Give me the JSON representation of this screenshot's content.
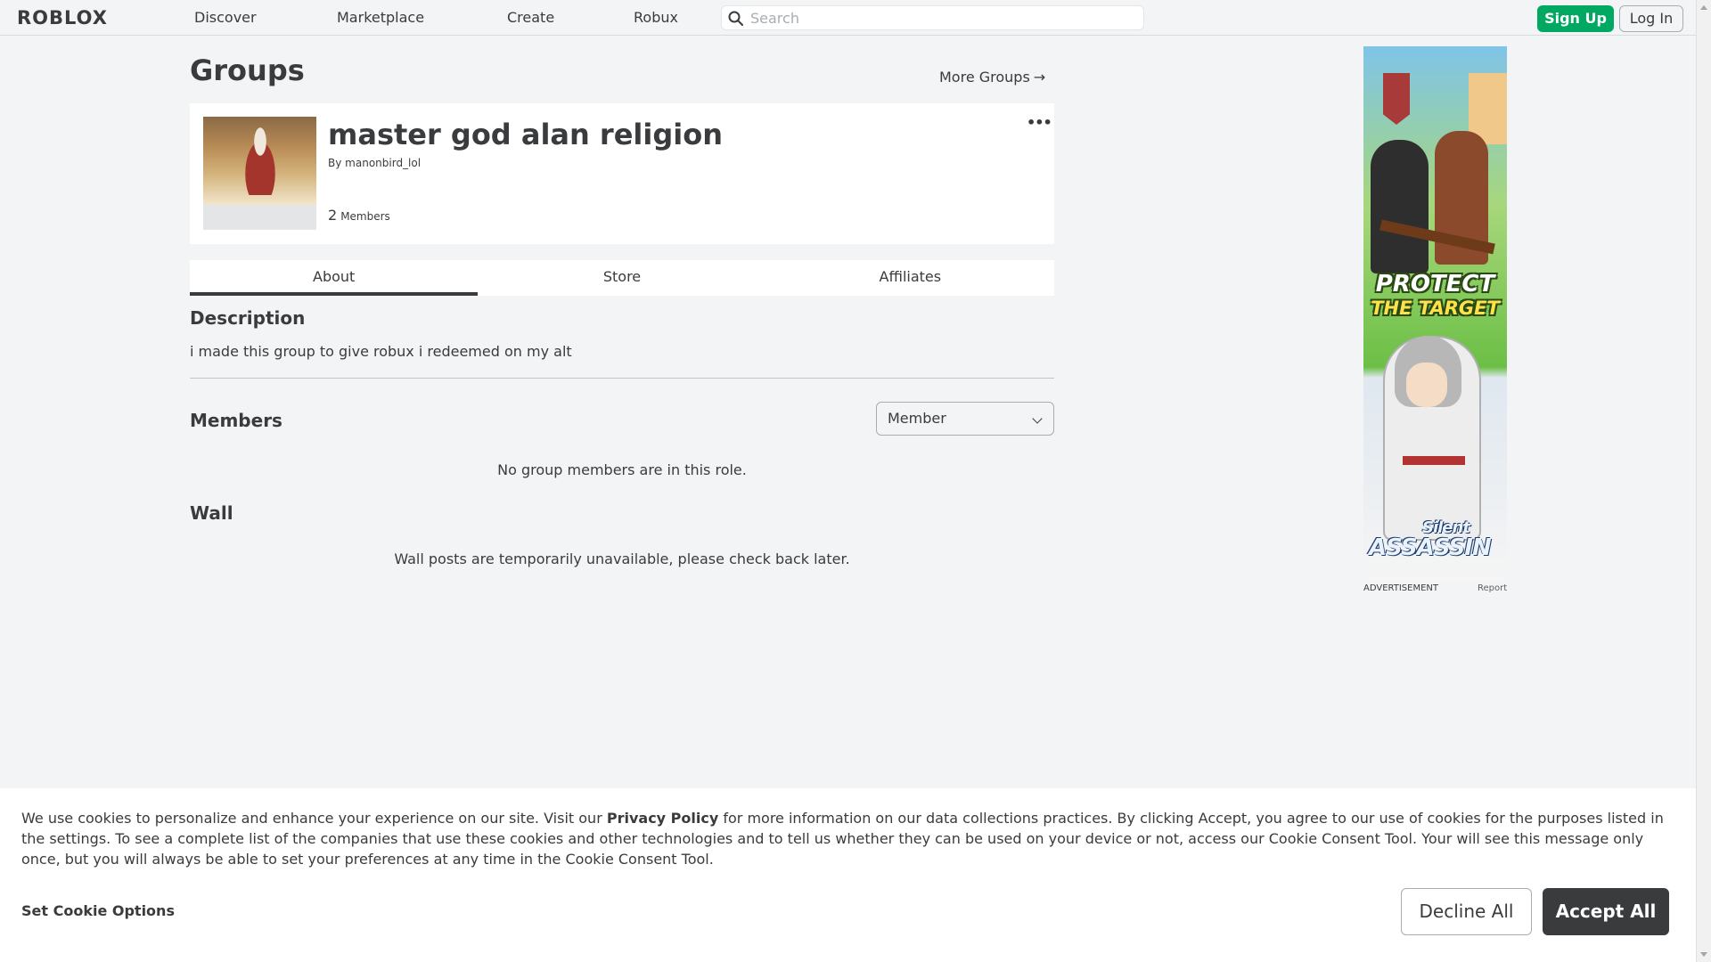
{
  "nav": {
    "logo": "ROBLOX",
    "links": [
      "Discover",
      "Marketplace",
      "Create",
      "Robux"
    ],
    "search_placeholder": "Search",
    "signup_label": "Sign Up",
    "login_label": "Log In"
  },
  "page": {
    "title": "Groups",
    "more_groups_label": "More Groups",
    "more_groups_arrow": "→"
  },
  "group": {
    "name": "master god alan religion",
    "by_label": "By",
    "owner": "manonbird_lol",
    "member_count": "2",
    "member_label": "Members",
    "more_menu": "•••"
  },
  "tabs": [
    "About",
    "Store",
    "Affiliates"
  ],
  "active_tab": "About",
  "about": {
    "description_title": "Description",
    "description_text": "i made this group to give robux i redeemed on my alt",
    "members_title": "Members",
    "role_selected": "Member",
    "no_members_text": "No group members are in this role.",
    "wall_title": "Wall",
    "wall_text": "Wall posts are temporarily unavailable, please check back later."
  },
  "ad": {
    "headline_1": "PROTECT",
    "headline_2": "THE TARGET",
    "brand_small": "Silent",
    "brand_large": "ASSASSIN",
    "label": "ADVERTISEMENT",
    "report_label": "Report"
  },
  "cookie": {
    "text_before": "We use cookies to personalize and enhance your experience on our site. Visit our ",
    "privacy_link": "Privacy Policy",
    "text_after": " for more information on our data collections practices. By clicking Accept, you agree to our use of cookies for the purposes listed in the settings. To see a complete list of the companies that use these cookies and other technologies and to tell us whether they can be used on your device or not, access our Cookie Consent Tool. Your will see this message only once, but you will always be able to set your preferences at any time in the Cookie Consent Tool.",
    "options_label": "Set Cookie Options",
    "decline_label": "Decline All",
    "accept_label": "Accept All"
  },
  "colors": {
    "signup_green": "#00a862",
    "accept_dark": "#393b3d",
    "background": "#f2f4f5"
  }
}
